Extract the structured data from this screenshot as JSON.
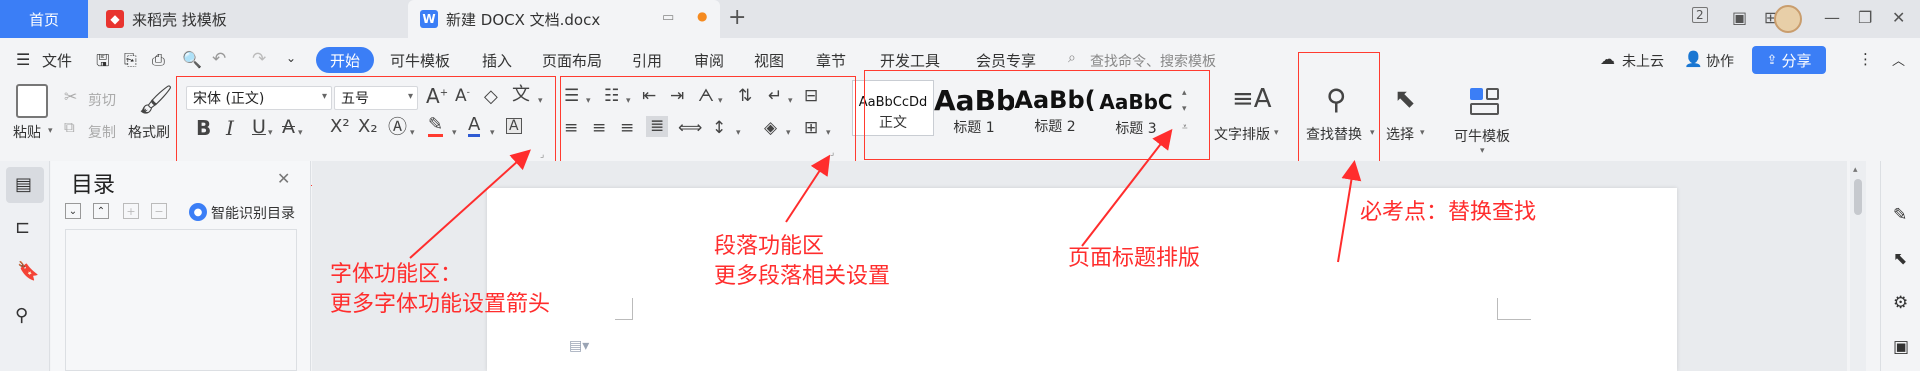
{
  "tabs": {
    "home": "首页",
    "inactive": "来稻壳 找模板",
    "active": "新建 DOCX 文档.docx"
  },
  "menu": {
    "file": "文件",
    "start": "开始",
    "items": [
      "可牛模板",
      "插入",
      "页面布局",
      "引用",
      "审阅",
      "视图",
      "章节",
      "开发工具",
      "会员专享"
    ],
    "search_placeholder": "查找命令、搜索模板",
    "cloud": "未上云",
    "collab": "协作",
    "share": "分享"
  },
  "toolbar": {
    "paste": "粘贴",
    "cut": "剪切",
    "copy": "复制",
    "format_painter": "格式刷",
    "font_name": "宋体 (正文)",
    "font_size": "五号",
    "styles": [
      {
        "sample": "AaBbCcDd",
        "name": "正文"
      },
      {
        "sample": "AaBb",
        "name": "标题 1"
      },
      {
        "sample": "AaBb(",
        "name": "标题 2"
      },
      {
        "sample": "AaBbC",
        "name": "标题 3"
      }
    ],
    "text_layout": "文字排版",
    "find_replace": "查找替换",
    "select": "选择",
    "kn_template": "可牛模板"
  },
  "toc": {
    "title": "目录",
    "smart_toc": "智能识别目录"
  },
  "annotations": {
    "font_area_line1": "字体功能区：",
    "font_area_line2": "更多字体功能设置箭头",
    "para_area_line1": "段落功能区",
    "para_area_line2": "更多段落相关设置",
    "heading_layout": "页面标题排版",
    "key_point": "必考点：替换查找"
  },
  "colors": {
    "accent": "#3b7ef6",
    "annotation": "#ff2d2d"
  }
}
